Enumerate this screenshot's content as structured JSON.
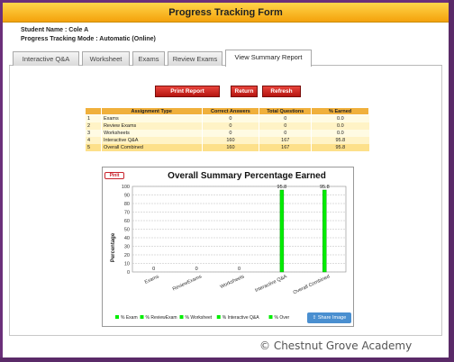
{
  "header": {
    "title": "Progress Tracking Form"
  },
  "student": {
    "name_line": "Student Name : Cole A",
    "mode_line": "Progress Tracking Mode : Automatic (Online)"
  },
  "tabs": [
    {
      "label": "Interactive Q&A"
    },
    {
      "label": "Worksheet"
    },
    {
      "label": "Exams"
    },
    {
      "label": "Review Exams"
    },
    {
      "label": "View Summary Report",
      "active": true
    }
  ],
  "buttons": {
    "print": "Print Report",
    "return": "Return",
    "refresh": "Refresh"
  },
  "table": {
    "headers": [
      "",
      "Assignment Type",
      "Correct Answers",
      "Total Questions",
      "% Earned"
    ],
    "rows": [
      [
        "1",
        "Exams",
        "0",
        "0",
        "0.0"
      ],
      [
        "2",
        "Review Exams",
        "0",
        "0",
        "0.0"
      ],
      [
        "3",
        "Worksheets",
        "0",
        "0",
        "0.0"
      ],
      [
        "4",
        "Interactive Q&A",
        "160",
        "167",
        "95.8"
      ],
      [
        "5",
        "Overall Combined",
        "160",
        "167",
        "95.8"
      ]
    ]
  },
  "pinit_label": "Pinit",
  "share_label": "Share Image",
  "chart_data": {
    "type": "bar",
    "title": "Overall Summary Percentage Earned",
    "ylabel": "Percentage",
    "xlabel": "",
    "ylim": [
      0,
      100
    ],
    "yticks": [
      "0",
      "10",
      "20",
      "30",
      "40",
      "50",
      "60",
      "70",
      "80",
      "90",
      "100"
    ],
    "grid": true,
    "categories": [
      "Exams",
      "ReviewExams",
      "Worksheets",
      "Interactive Q&A",
      "Overall Combined"
    ],
    "values": [
      0,
      0,
      0,
      95.8,
      95.8
    ],
    "data_labels": [
      "0",
      "0",
      "0",
      "95.8",
      "95.8"
    ],
    "bar_color": "#00ee00",
    "legend": [
      "% Exam",
      "% ReviewExam",
      "% Worksheet",
      "% Interactive Q&A",
      "% Overall Combined"
    ],
    "legend_visible": [
      "% Exam",
      "% ReviewExam",
      "% Worksheet",
      "% Interactive Q&A",
      "% Over"
    ],
    "legend_position": "bottom"
  },
  "watermark": "© Chestnut Grove Academy"
}
